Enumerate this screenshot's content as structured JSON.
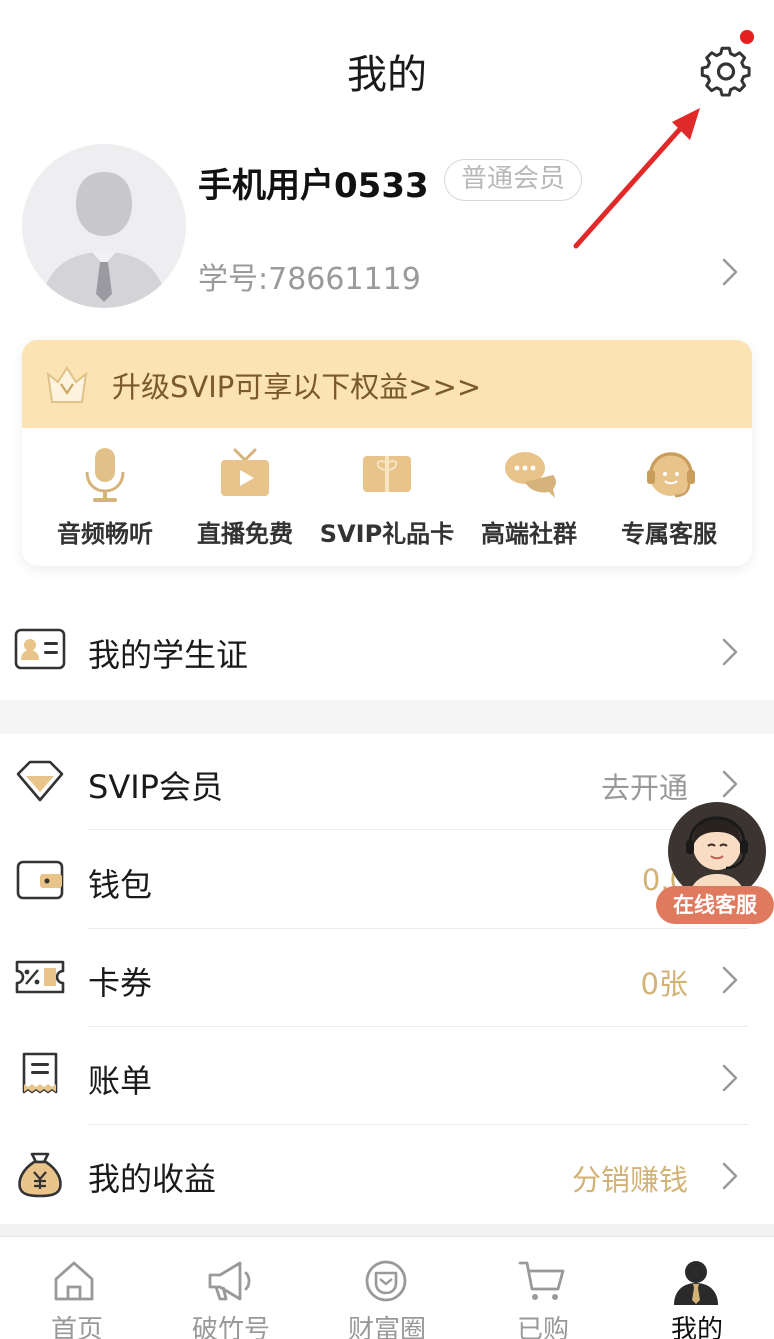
{
  "header": {
    "title": "我的"
  },
  "profile": {
    "username": "手机用户0533",
    "member_level": "普通会员",
    "student_id": "学号:78661119"
  },
  "svip": {
    "banner_text": "升级SVIP可享以下权益>>>",
    "perks": [
      {
        "label": "音频畅听",
        "icon": "microphone-icon"
      },
      {
        "label": "直播免费",
        "icon": "tv-icon"
      },
      {
        "label": "SVIP礼品卡",
        "icon": "gift-card-icon"
      },
      {
        "label": "高端社群",
        "icon": "chat-bubbles-icon"
      },
      {
        "label": "专属客服",
        "icon": "headset-icon"
      }
    ]
  },
  "menu": {
    "student_card": {
      "label": "我的学生证"
    },
    "svip_member": {
      "label": "SVIP会员",
      "value": "去开通"
    },
    "wallet": {
      "label": "钱包",
      "value": "0.0"
    },
    "coupons": {
      "label": "卡券",
      "value": "0张"
    },
    "bills": {
      "label": "账单"
    },
    "earnings": {
      "label": "我的收益",
      "value": "分销赚钱"
    }
  },
  "floating_service": {
    "label": "在线客服"
  },
  "bottom_nav": [
    {
      "label": "首页",
      "icon": "home-icon",
      "active": false
    },
    {
      "label": "破竹号",
      "icon": "megaphone-icon",
      "active": false
    },
    {
      "label": "财富圈",
      "icon": "circle-icon",
      "active": false
    },
    {
      "label": "已购",
      "icon": "cart-icon",
      "active": false
    },
    {
      "label": "我的",
      "icon": "user-icon",
      "active": true
    }
  ],
  "colors": {
    "accent_gold": "#d3b276",
    "banner_bg": "#fbe3b3",
    "value_gray": "#999999",
    "notification_red": "#e42020",
    "cs_pill": "#e07a5f"
  }
}
